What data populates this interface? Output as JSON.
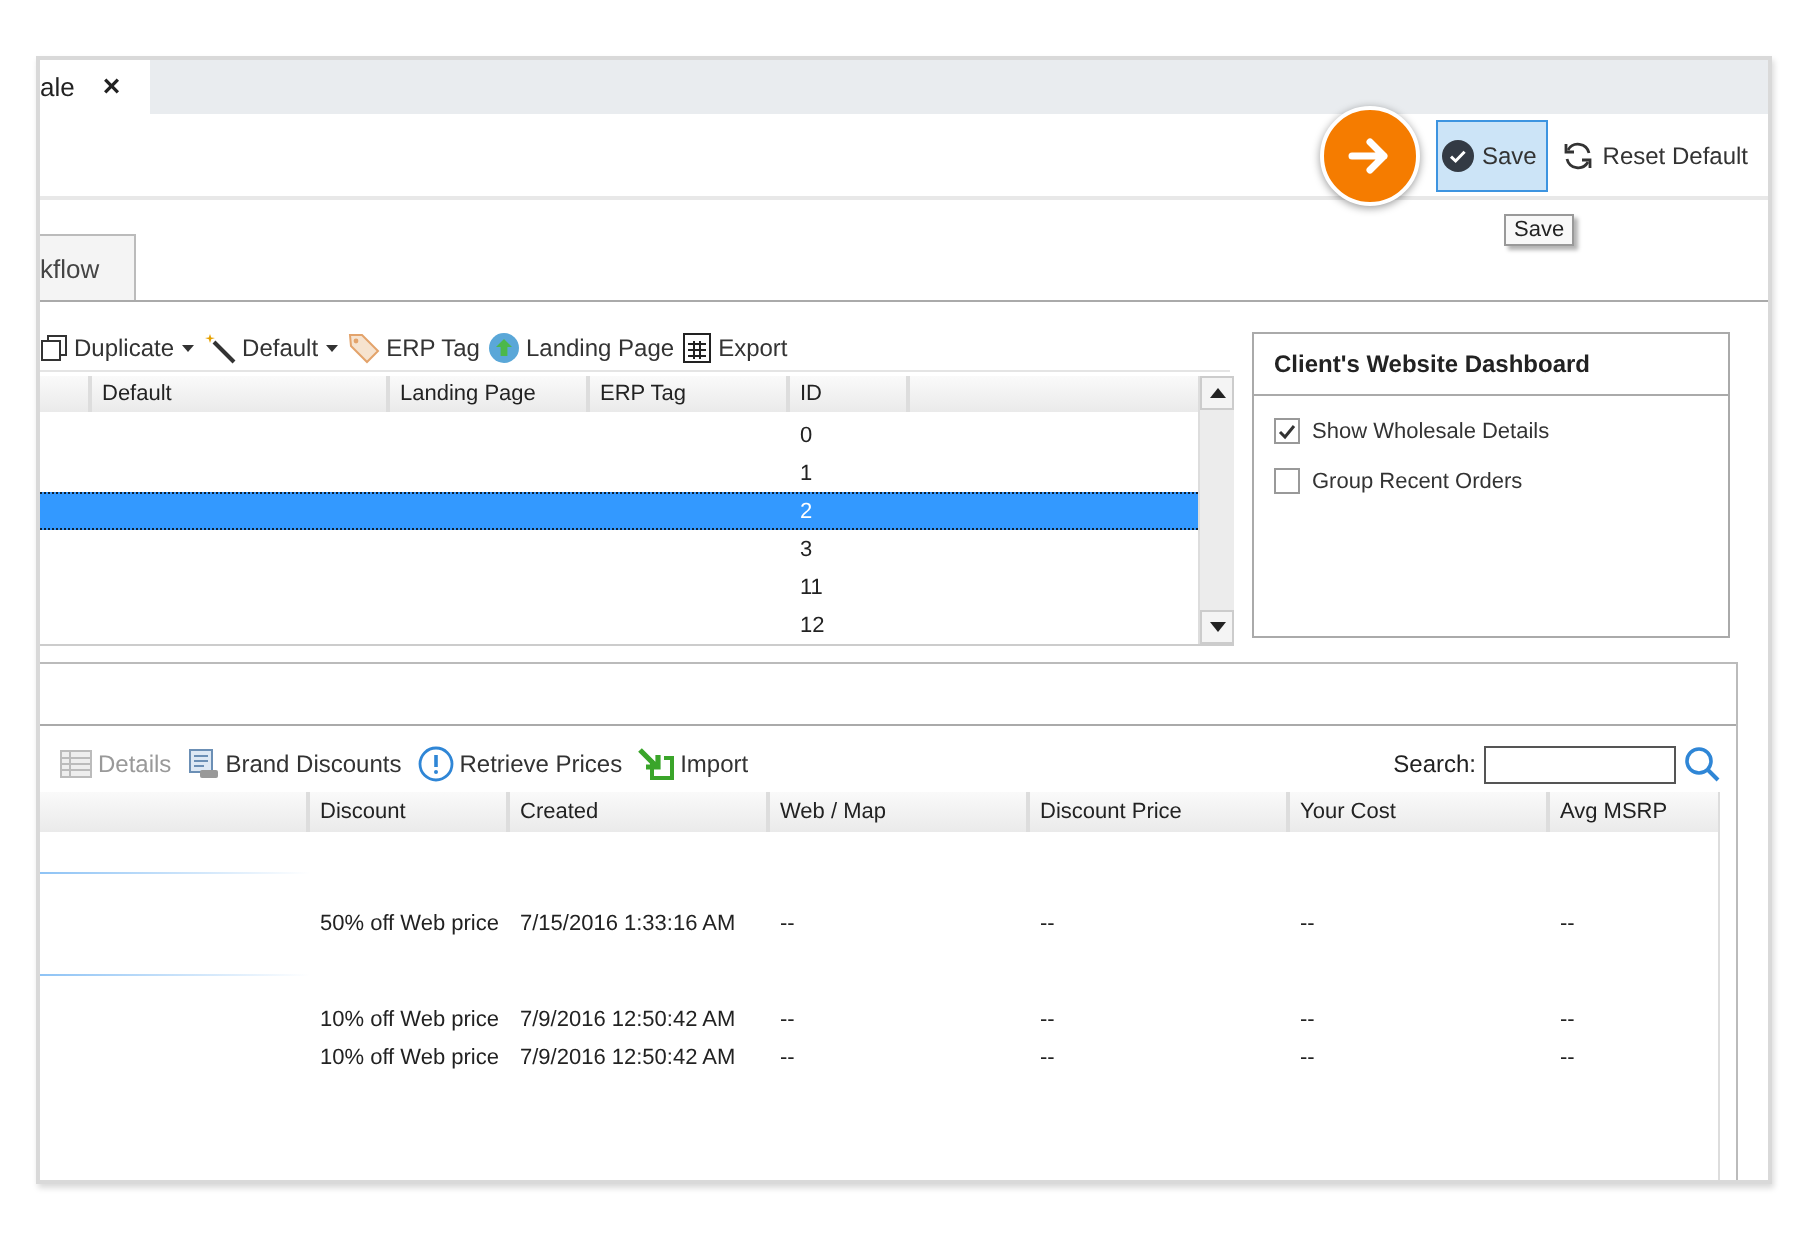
{
  "document_tab": {
    "label": "ale",
    "close": "×",
    "selected": true
  },
  "toolbar": [
    {
      "kind": "save",
      "label": "Save",
      "highlighted": true
    },
    {
      "kind": "reset",
      "label": "Reset Default",
      "highlighted": false
    }
  ],
  "tooltip": "Save",
  "tabs": [
    {
      "label": "kflow",
      "selected": true
    }
  ],
  "grid_toolbar": [
    {
      "kind": "duplicate",
      "label": "Duplicate",
      "dropdown": true
    },
    {
      "kind": "default",
      "label": "Default",
      "dropdown": true
    },
    {
      "kind": "erp",
      "label": "ERP Tag",
      "dropdown": false
    },
    {
      "kind": "landing",
      "label": "Landing Page",
      "dropdown": false
    },
    {
      "kind": "export",
      "label": "Export",
      "dropdown": false
    }
  ],
  "grid": {
    "columns": [
      "Default",
      "Landing Page",
      "ERP Tag",
      "ID"
    ],
    "rows": [
      {
        "value": "0",
        "selected": false
      },
      {
        "value": "1",
        "selected": false
      },
      {
        "value": "2",
        "selected": true
      },
      {
        "value": "3",
        "selected": false
      },
      {
        "value": "11",
        "selected": false
      },
      {
        "value": "12",
        "selected": false
      }
    ]
  },
  "dashboard": {
    "title": "Client's Website Dashboard",
    "options": [
      {
        "label": "Show Wholesale Details",
        "checked": true
      },
      {
        "label": "Group Recent Orders",
        "checked": false
      }
    ]
  },
  "products": {
    "toolbar": [
      {
        "kind": "details",
        "label": "Details",
        "disabled": true
      },
      {
        "kind": "brand",
        "label": "Brand Discounts",
        "disabled": false
      },
      {
        "kind": "retrieve",
        "label": "Retrieve Prices",
        "disabled": false
      },
      {
        "kind": "import",
        "label": "Import",
        "disabled": false
      }
    ],
    "search_label": "Search:",
    "columns": [
      "Discount",
      "Created",
      "Web / Map",
      "Discount Price",
      "Your Cost",
      "Avg MSRP"
    ],
    "rows": [
      {
        "highlighted": true,
        "cells": [
          "50% off Web price",
          "7/15/2016 1:33:16 AM",
          "--",
          "--",
          "--",
          "--"
        ]
      },
      {
        "highlighted": false,
        "cells": [
          "10% off Web price",
          "7/9/2016 12:50:42 AM",
          "--",
          "--",
          "--",
          "--"
        ]
      },
      {
        "highlighted": false,
        "cells": [
          "10% off Web price",
          "7/9/2016 12:50:42 AM",
          "--",
          "--",
          "--",
          "--"
        ]
      }
    ]
  }
}
